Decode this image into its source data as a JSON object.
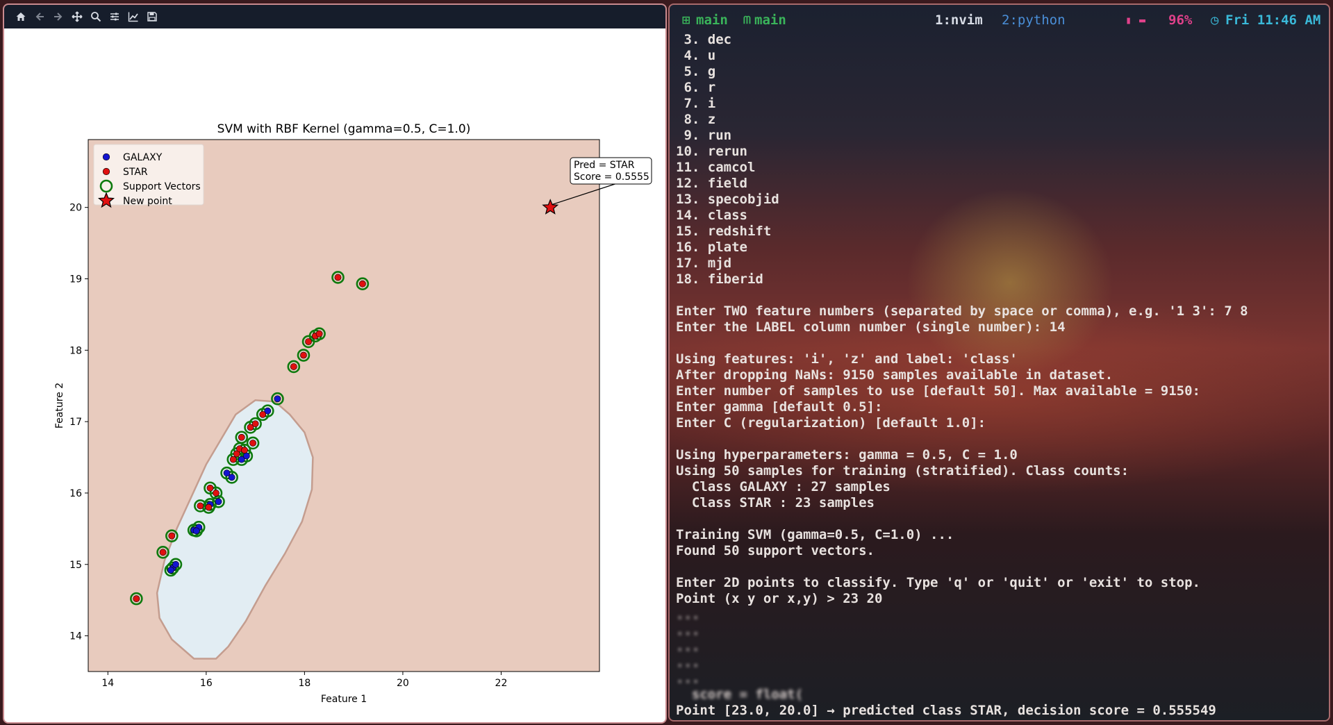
{
  "mpl_window": {
    "toolbar": [
      {
        "name": "home-icon"
      },
      {
        "name": "back-arrow-icon"
      },
      {
        "name": "forward-arrow-icon"
      },
      {
        "name": "pan-icon"
      },
      {
        "name": "zoom-icon"
      },
      {
        "name": "configure-subplots-icon"
      },
      {
        "name": "edit-axis-icon"
      },
      {
        "name": "save-icon"
      }
    ]
  },
  "chart_data": {
    "type": "scatter",
    "title": "SVM with RBF Kernel (gamma=0.5, C=1.0)",
    "xlabel": "Feature 1",
    "ylabel": "Feature 2",
    "xlim": [
      13.6,
      24.0
    ],
    "ylim": [
      13.5,
      20.95
    ],
    "xticks": [
      14,
      16,
      18,
      20,
      22
    ],
    "yticks": [
      14,
      15,
      16,
      17,
      18,
      19,
      20
    ],
    "grid": false,
    "legend_position": "top-left",
    "legend": [
      {
        "label": "GALAXY",
        "marker": "blue-dot"
      },
      {
        "label": "STAR",
        "marker": "red-dot"
      },
      {
        "label": "Support Vectors",
        "marker": "green-ring"
      },
      {
        "label": "New point",
        "marker": "red-star"
      }
    ],
    "colors": {
      "star_region": "#e8cbbe",
      "galaxy_region": "#e2edf3",
      "boundary": "#c49d8f",
      "galaxy": "#1414d0",
      "star": "#e01010",
      "support_vector_ring": "#0e7a0e"
    },
    "galaxy_region_outline": [
      [
        15.75,
        13.68
      ],
      [
        16.2,
        13.68
      ],
      [
        16.45,
        13.85
      ],
      [
        16.8,
        14.2
      ],
      [
        17.2,
        14.7
      ],
      [
        17.6,
        15.15
      ],
      [
        17.95,
        15.6
      ],
      [
        18.15,
        16.05
      ],
      [
        18.17,
        16.5
      ],
      [
        18.0,
        16.85
      ],
      [
        17.7,
        17.1
      ],
      [
        17.4,
        17.28
      ],
      [
        17.0,
        17.3
      ],
      [
        16.6,
        17.1
      ],
      [
        16.3,
        16.75
      ],
      [
        16.0,
        16.4
      ],
      [
        15.7,
        15.95
      ],
      [
        15.4,
        15.5
      ],
      [
        15.15,
        15.05
      ],
      [
        15.0,
        14.6
      ],
      [
        15.05,
        14.25
      ],
      [
        15.3,
        13.95
      ],
      [
        15.75,
        13.68
      ]
    ],
    "series": [
      {
        "name": "GALAXY",
        "points": [
          [
            15.32,
            14.95
          ],
          [
            15.38,
            15.0
          ],
          [
            15.28,
            14.92
          ],
          [
            15.75,
            15.48
          ],
          [
            15.85,
            15.52
          ],
          [
            16.25,
            15.88
          ],
          [
            16.08,
            15.84
          ],
          [
            16.42,
            16.28
          ],
          [
            16.52,
            16.22
          ],
          [
            16.72,
            16.47
          ],
          [
            16.82,
            16.52
          ],
          [
            17.25,
            17.15
          ],
          [
            17.45,
            17.32
          ],
          [
            15.8,
            15.47
          ]
        ]
      },
      {
        "name": "STAR",
        "points": [
          [
            14.58,
            14.52
          ],
          [
            15.12,
            15.17
          ],
          [
            15.3,
            15.4
          ],
          [
            15.88,
            15.82
          ],
          [
            16.05,
            15.8
          ],
          [
            16.08,
            16.07
          ],
          [
            16.2,
            16.0
          ],
          [
            16.55,
            16.47
          ],
          [
            16.62,
            16.55
          ],
          [
            16.68,
            16.62
          ],
          [
            16.72,
            16.78
          ],
          [
            16.95,
            16.7
          ],
          [
            16.9,
            16.92
          ],
          [
            17.0,
            16.97
          ],
          [
            17.15,
            17.1
          ],
          [
            17.78,
            17.77
          ],
          [
            17.98,
            17.93
          ],
          [
            18.08,
            18.12
          ],
          [
            18.22,
            18.2
          ],
          [
            18.3,
            18.23
          ],
          [
            18.68,
            19.02
          ],
          [
            19.18,
            18.93
          ],
          [
            16.78,
            16.6
          ]
        ]
      },
      {
        "name": "New point",
        "points": [
          [
            23.0,
            20.0
          ]
        ]
      }
    ],
    "annotation": {
      "lines": [
        "Pred = STAR",
        "Score = 0.5555"
      ]
    }
  },
  "terminal": {
    "statusbar": {
      "session_icon": "⊞",
      "session_name": "main",
      "branch_icon": "ᗰ",
      "branch_name": "main",
      "branch_glyph": "",
      "window_1": "1:nvim",
      "window_2": "2:python",
      "battery_icon": "▮",
      "battery_pct": "96%",
      "clock_icon": "◷",
      "clock": "Fri 11:46 AM"
    },
    "lines": [
      {
        "text": " 3. dec"
      },
      {
        "text": " 4. u"
      },
      {
        "text": " 5. g"
      },
      {
        "text": " 6. r"
      },
      {
        "text": " 7. i"
      },
      {
        "text": " 8. z"
      },
      {
        "text": " 9. run"
      },
      {
        "text": "10. rerun"
      },
      {
        "text": "11. camcol"
      },
      {
        "text": "12. field"
      },
      {
        "text": "13. specobjid"
      },
      {
        "text": "14. class"
      },
      {
        "text": "15. redshift"
      },
      {
        "text": "16. plate"
      },
      {
        "text": "17. mjd"
      },
      {
        "text": "18. fiberid"
      },
      {
        "text": ""
      },
      {
        "text": "Enter TWO feature numbers (separated by space or comma), e.g. '1 3': 7 8"
      },
      {
        "text": "Enter the LABEL column number (single number): 14"
      },
      {
        "text": ""
      },
      {
        "text": "Using features: 'i', 'z' and label: 'class'"
      },
      {
        "text": "After dropping NaNs: 9150 samples available in dataset."
      },
      {
        "text": "Enter number of samples to use [default 50]. Max available = 9150:"
      },
      {
        "text": "Enter gamma [default 0.5]:"
      },
      {
        "text": "Enter C (regularization) [default 1.0]:"
      },
      {
        "text": ""
      },
      {
        "text": "Using hyperparameters: gamma = 0.5, C = 1.0"
      },
      {
        "text": "Using 50 samples for training (stratified). Class counts:"
      },
      {
        "text": "  Class GALAXY : 27 samples"
      },
      {
        "text": "  Class STAR : 23 samples"
      },
      {
        "text": ""
      },
      {
        "text": "Training SVM (gamma=0.5, C=1.0) ..."
      },
      {
        "text": "Found 50 support vectors."
      },
      {
        "text": ""
      },
      {
        "text": "Enter 2D points to classify. Type 'q' or 'quit' or 'exit' to stop."
      },
      {
        "text": "Point (x y or x,y) > 23 20"
      },
      {
        "text": "...",
        "blurred": true
      },
      {
        "text": "...",
        "blurred": true
      },
      {
        "text": "...",
        "blurred": true
      },
      {
        "text": "...",
        "blurred": true
      },
      {
        "text": "...",
        "blurred": true
      },
      {
        "text": "  score = float(",
        "blurred": true
      },
      {
        "text": "Point [23.0, 20.0] → predicted class STAR, decision score = 0.555549"
      }
    ]
  }
}
